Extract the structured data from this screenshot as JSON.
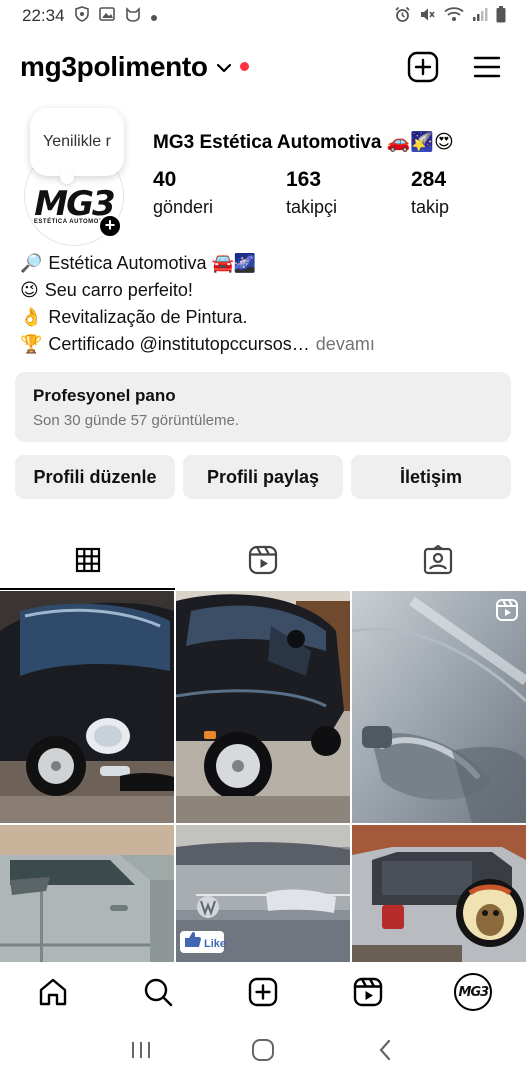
{
  "status_bar": {
    "time": "22:34",
    "left_icons": [
      "shield-icon",
      "image-icon",
      "cat-icon",
      "dot-icon"
    ],
    "right_icons": [
      "alarm-icon",
      "mute-icon",
      "wifi-icon",
      "signal-icon",
      "battery-icon"
    ]
  },
  "header": {
    "username": "mg3polimento",
    "chevron": "⌄",
    "create_icon": "plus-square-icon",
    "menu_icon": "hamburger-menu-icon"
  },
  "profile": {
    "note_text": "Yenilikle r",
    "avatar_logo": "MG3",
    "avatar_sub": "ESTÉTICA AUTOMOTIVA",
    "display_name": "MG3 Estética Automotiva 🚗🌠😍",
    "stats": [
      {
        "value": "40",
        "label": "gönderi"
      },
      {
        "value": "163",
        "label": "takipçi"
      },
      {
        "value": "284",
        "label": "takip"
      }
    ]
  },
  "bio": {
    "lines": [
      {
        "emoji": "🔎",
        "text": "Estética Automotiva 🚘🌌"
      },
      {
        "emoji": "😉",
        "text": "Seu carro perfeito!"
      },
      {
        "emoji": "👌",
        "text": "Revitalização de Pintura."
      },
      {
        "emoji": "🏆",
        "text": "Certificado @institutopccursos…"
      }
    ],
    "more_label": "devamı"
  },
  "professional_dashboard": {
    "title": "Profesyonel pano",
    "subtitle": "Son 30 günde 57 görüntüleme."
  },
  "buttons": {
    "edit": "Profili düzenle",
    "share": "Profili paylaş",
    "contact": "İletişim"
  },
  "tabs": [
    {
      "icon": "grid-icon",
      "active": true
    },
    {
      "icon": "reels-icon",
      "active": false
    },
    {
      "icon": "tagged-icon",
      "active": false
    }
  ],
  "grid_posts": [
    {
      "subject": "black Fiat 500 front",
      "has_reel_badge": false
    },
    {
      "subject": "black Fiat 500 side",
      "has_reel_badge": false
    },
    {
      "subject": "silver car door handle",
      "has_reel_badge": true
    },
    {
      "subject": "silver car side door",
      "has_reel_badge": false
    },
    {
      "subject": "VW car front with Like sticker",
      "has_reel_badge": false
    },
    {
      "subject": "silver SUV rear with spare tire cover",
      "has_reel_badge": false
    }
  ],
  "stickers": {
    "like_text": "Like"
  },
  "bottom_nav": {
    "items": [
      "home-icon",
      "search-icon",
      "create-icon",
      "reels-icon",
      "profile-avatar"
    ],
    "avatar_text": "MG3"
  },
  "colors": {
    "notification_dot": "#ff3040",
    "button_bg": "#efefef",
    "secondary_text": "#737373"
  }
}
